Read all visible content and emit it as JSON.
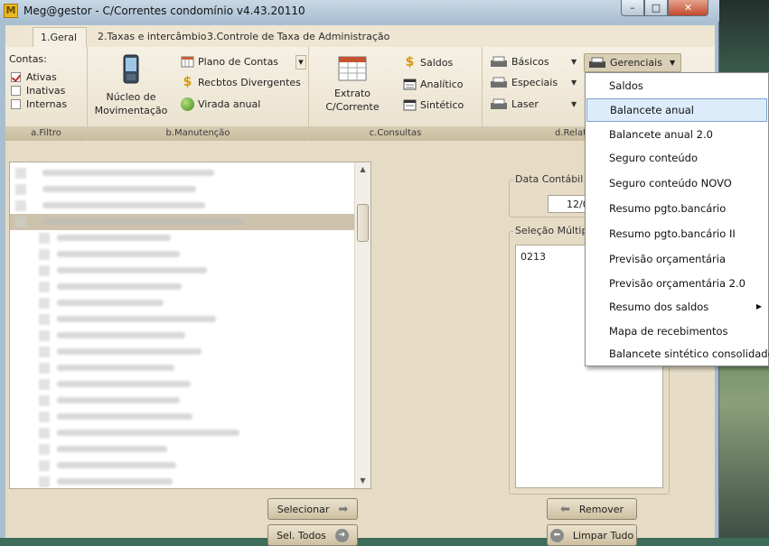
{
  "window": {
    "title": "Meg@gestor - C/Correntes condomínio v4.43.20110",
    "icon_letter": "M",
    "min_label": "–",
    "max_label": "□",
    "close_label": "✕"
  },
  "tabs": [
    "1.Geral",
    "2.Taxas e intercâmbio",
    "3.Controle de Taxa de Administração"
  ],
  "ribbon": {
    "filtro": {
      "title": "Contas:",
      "checks": [
        {
          "label": "Ativas",
          "checked": true
        },
        {
          "label": "Inativas",
          "checked": false
        },
        {
          "label": "Internas",
          "checked": false
        }
      ],
      "group_label": "a.Filtro"
    },
    "manutencao": {
      "big_button": "Núcleo de Movimentação",
      "items": [
        "Plano de Contas",
        "Recbtos Divergentes",
        "Virada anual"
      ],
      "group_label": "b.Manutenção"
    },
    "consultas": {
      "big_button": "Extrato C/Corrente",
      "items": [
        "Saldos",
        "Analítico",
        "Sintético"
      ],
      "group_label": "c.Consultas"
    },
    "relatorios": {
      "items": [
        "Básicos",
        "Especiais",
        "Laser"
      ],
      "gerenciais": "Gerenciais",
      "group_label": "d.Relat"
    }
  },
  "main": {
    "data_contabil_label": "Data Contábil",
    "data_contabil_value": "12/0",
    "selecao_label": "Seleção Múltipla",
    "selected_items": [
      "0213"
    ],
    "buttons": {
      "selecionar": "Selecionar",
      "sel_todos": "Sel. Todos",
      "remover": "Remover",
      "limpar_tudo": "Limpar Tudo"
    }
  },
  "menu": {
    "items": [
      {
        "label": "Saldos",
        "highlighted": false,
        "submenu": false
      },
      {
        "label": "Balancete anual",
        "highlighted": true,
        "submenu": false
      },
      {
        "label": "Balancete anual 2.0",
        "highlighted": false,
        "submenu": false
      },
      {
        "label": "Seguro conteúdo",
        "highlighted": false,
        "submenu": false
      },
      {
        "label": "Seguro conteúdo NOVO",
        "highlighted": false,
        "submenu": false
      },
      {
        "label": "Resumo pgto.bancário",
        "highlighted": false,
        "submenu": false
      },
      {
        "label": "Resumo pgto.bancário II",
        "highlighted": false,
        "submenu": false
      },
      {
        "label": "Previsão orçamentária",
        "highlighted": false,
        "submenu": false
      },
      {
        "label": "Previsão orçamentária 2.0",
        "highlighted": false,
        "submenu": false
      },
      {
        "label": "Resumo dos saldos",
        "highlighted": false,
        "submenu": true
      },
      {
        "label": "Mapa de recebimentos",
        "highlighted": false,
        "submenu": false
      },
      {
        "label": "Balancete sintético consolidado",
        "highlighted": false,
        "submenu": false
      }
    ]
  },
  "colors": {
    "accent_highlight": "#dcecfb",
    "panel_bg": "#e6dcc6",
    "check_red": "#c0282a"
  }
}
